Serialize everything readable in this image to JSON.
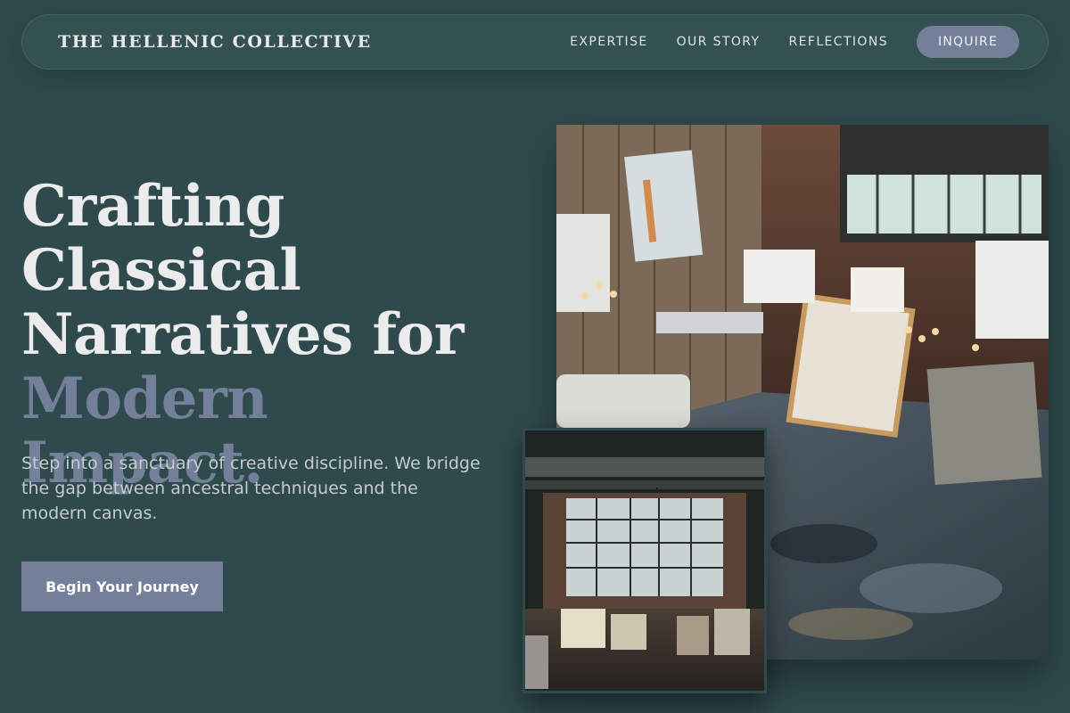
{
  "nav": {
    "brand": "THE HELLENIC COLLECTIVE",
    "links": [
      "EXPERTISE",
      "OUR STORY",
      "REFLECTIONS"
    ],
    "cta": "INQUIRE"
  },
  "hero": {
    "headline_lines": [
      "Crafting",
      "Classical",
      "Narratives for"
    ],
    "headline_accent": "Modern Impact.",
    "subtitle": "Step into a sanctuary of creative discipline. We bridge the gap between ancestral techniques and the modern canvas.",
    "cta": "Begin Your Journey"
  },
  "colors": {
    "background": "#2f4a4c",
    "accent": "#74809a",
    "text": "#ececec"
  }
}
